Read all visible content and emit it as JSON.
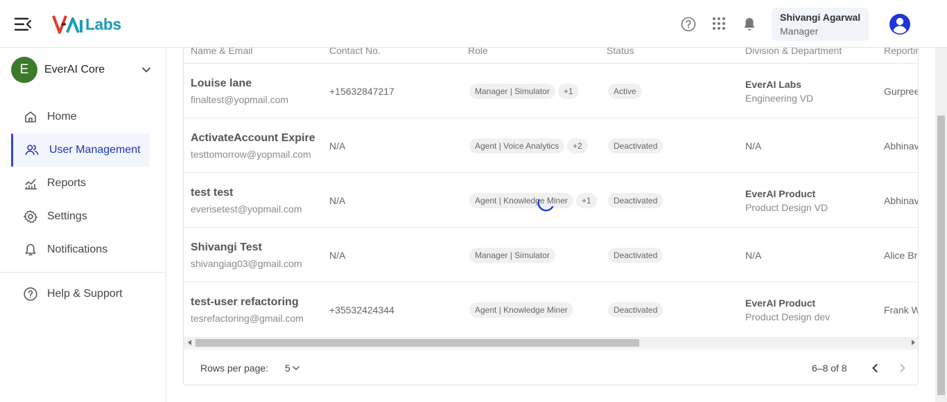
{
  "header": {
    "logo_text": "Labs",
    "logo_mark": "V-AI",
    "user_name": "Shivangi Agarwal",
    "user_role": "Manager",
    "icons": [
      "menu-collapse-icon",
      "help-circle-icon",
      "apps-grid-icon",
      "bell-icon",
      "user-avatar-icon"
    ]
  },
  "sidebar": {
    "org_initial": "E",
    "org_name": "EverAI Core",
    "items": [
      {
        "label": "Home",
        "icon": "home-icon"
      },
      {
        "label": "User Management",
        "icon": "users-icon",
        "active": true
      },
      {
        "label": "Reports",
        "icon": "chart-icon"
      },
      {
        "label": "Settings",
        "icon": "gear-icon"
      },
      {
        "label": "Notifications",
        "icon": "bell-icon"
      }
    ],
    "help_label": "Help & Support"
  },
  "table": {
    "columns": [
      "Name & Email",
      "Contact No.",
      "Role",
      "Status",
      "Division & Department",
      "Reportin"
    ],
    "rows": [
      {
        "name": "Louise lane",
        "email": "finaltest@yopmail.com",
        "contact": "+15632847217",
        "role": "Manager | Simulator",
        "role_extra": "+1",
        "status": "Active",
        "division": "EverAI Labs",
        "department": "Engineering VD",
        "reporting": "Gurpree"
      },
      {
        "name": "ActivateAccount Expire",
        "email": "testtomorrow@yopmail.com",
        "contact": "N/A",
        "role": "Agent | Voice Analytics",
        "role_extra": "+2",
        "status": "Deactivated",
        "division": "N/A",
        "department": "",
        "reporting": "Abhinav"
      },
      {
        "name": "test test",
        "email": "everisetest@yopmail.com",
        "contact": "N/A",
        "role": "Agent | Knowledge Miner",
        "role_extra": "+1",
        "status": "Deactivated",
        "division": "EverAI Product",
        "department": "Product Design VD",
        "reporting": "Abhinav"
      },
      {
        "name": "Shivangi Test",
        "email": "shivangiag03@gmail.com",
        "contact": "N/A",
        "role": "Manager | Simulator",
        "role_extra": "",
        "status": "Deactivated",
        "division": "N/A",
        "department": "",
        "reporting": "Alice Br"
      },
      {
        "name": "test-user refactoring",
        "email": "tesrefactoring@gmail.com",
        "contact": "+35532424344",
        "role": "Agent | Knowledge Miner",
        "role_extra": "",
        "status": "Deactivated",
        "division": "EverAI Product",
        "department": "Product Design dev",
        "reporting": "Frank W"
      }
    ]
  },
  "pagination": {
    "rows_per_page_label": "Rows per page:",
    "rows_per_page_value": "5",
    "range_text": "6–8 of 8"
  },
  "colors": {
    "accent": "#1f35b5",
    "org_avatar": "#3d7a2c",
    "logo_teal": "#1c9bb5",
    "logo_red": "#e23b2e"
  }
}
